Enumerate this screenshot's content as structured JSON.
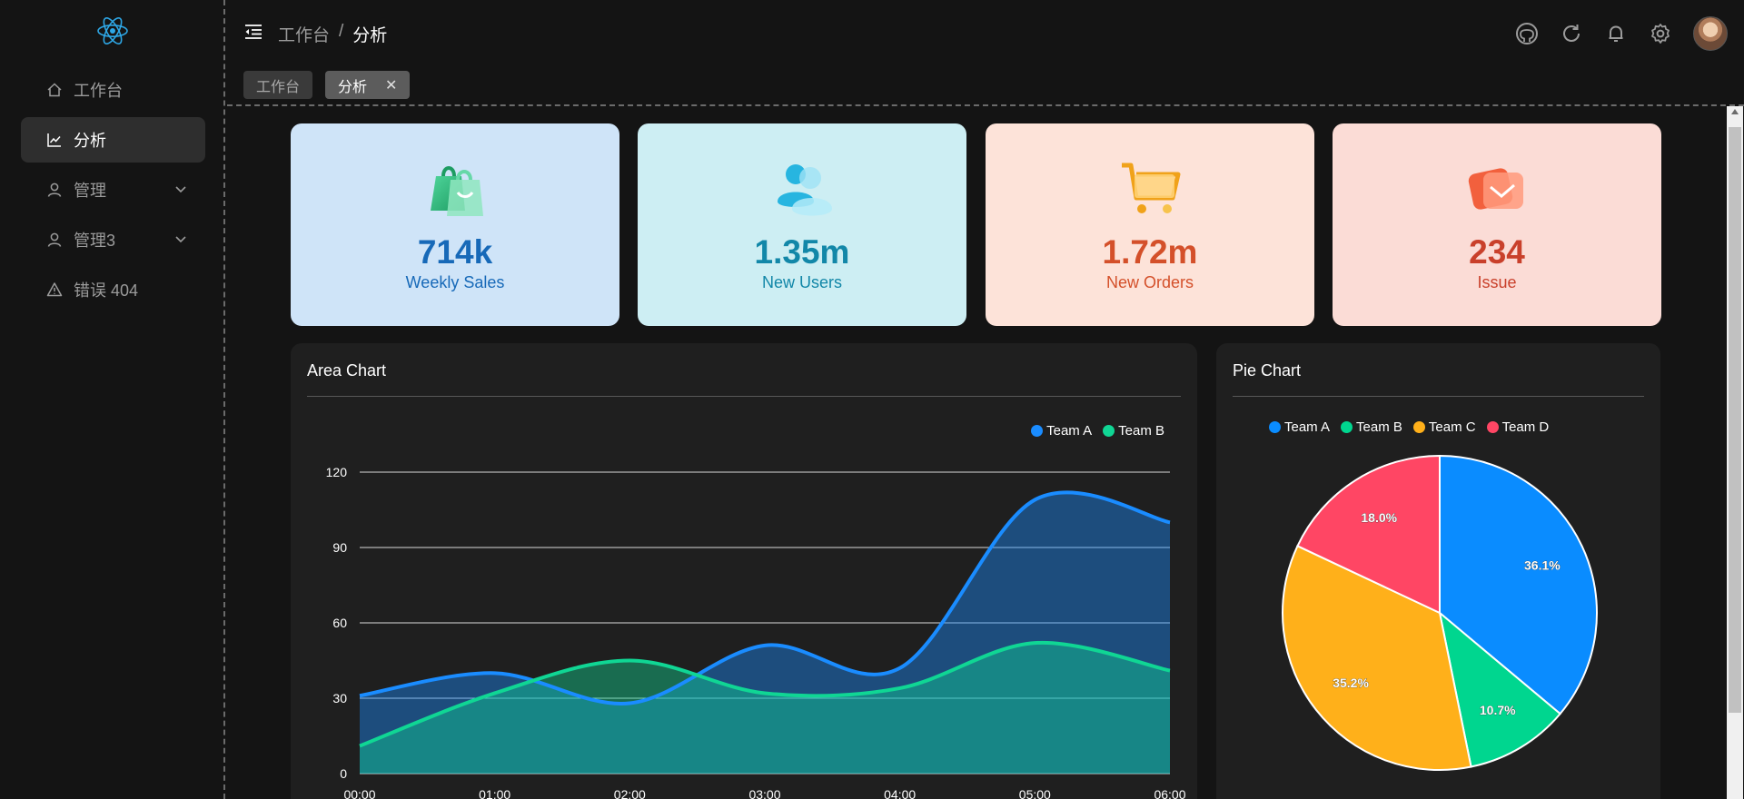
{
  "sidebar": {
    "items": [
      {
        "label": "工作台",
        "icon": "home-icon"
      },
      {
        "label": "分析",
        "icon": "line-chart-icon",
        "active": true
      },
      {
        "label": "管理",
        "icon": "user-icon",
        "expandable": true
      },
      {
        "label": "管理3",
        "icon": "user-icon",
        "expandable": true
      },
      {
        "label": "错误 404",
        "icon": "warning-icon"
      }
    ]
  },
  "header": {
    "breadcrumb": {
      "parent": "工作台",
      "separator": "/",
      "current": "分析"
    },
    "tabs": [
      {
        "label": "工作台"
      },
      {
        "label": "分析",
        "close": "✕"
      }
    ],
    "icons": [
      "github-icon",
      "refresh-icon",
      "bell-icon",
      "settings-icon",
      "avatar"
    ]
  },
  "stats": [
    {
      "value": "714k",
      "label": "Weekly Sales",
      "bg": "#cfe4f8",
      "color": "#1769b8"
    },
    {
      "value": "1.35m",
      "label": "New Users",
      "bg": "#cdeef3",
      "color": "#1287a8"
    },
    {
      "value": "1.72m",
      "label": "New Orders",
      "bg": "#fde3d9",
      "color": "#d4502a"
    },
    {
      "value": "234",
      "label": "Issue",
      "bg": "#fbdcd6",
      "color": "#c9402b"
    }
  ],
  "area_panel": {
    "title": "Area Chart"
  },
  "pie_panel": {
    "title": "Pie Chart"
  },
  "chart_data": [
    {
      "type": "area",
      "title": "Area Chart",
      "x": [
        "00:00",
        "01:00",
        "02:00",
        "03:00",
        "04:00",
        "05:00",
        "06:00"
      ],
      "ylim": [
        0,
        120
      ],
      "yticks": [
        0,
        30,
        60,
        90,
        120
      ],
      "grid": true,
      "legend": "top-right",
      "series": [
        {
          "name": "Team A",
          "color": "#1a8cff",
          "values": [
            31,
            40,
            28,
            51,
            42,
            109,
            100
          ]
        },
        {
          "name": "Team B",
          "color": "#10d694",
          "values": [
            11,
            32,
            45,
            32,
            34,
            52,
            41
          ]
        }
      ]
    },
    {
      "type": "pie",
      "title": "Pie Chart",
      "legend": "top",
      "slices": [
        {
          "name": "Team A",
          "value": 36.1,
          "label": "36.1%",
          "color": "#0a8cff"
        },
        {
          "name": "Team B",
          "value": 10.7,
          "label": "10.7%",
          "color": "#00d68f"
        },
        {
          "name": "Team C",
          "value": 35.2,
          "label": "35.2%",
          "color": "#ffb01a"
        },
        {
          "name": "Team D",
          "value": 18.0,
          "label": "18.0%",
          "color": "#ff4664"
        }
      ]
    }
  ]
}
